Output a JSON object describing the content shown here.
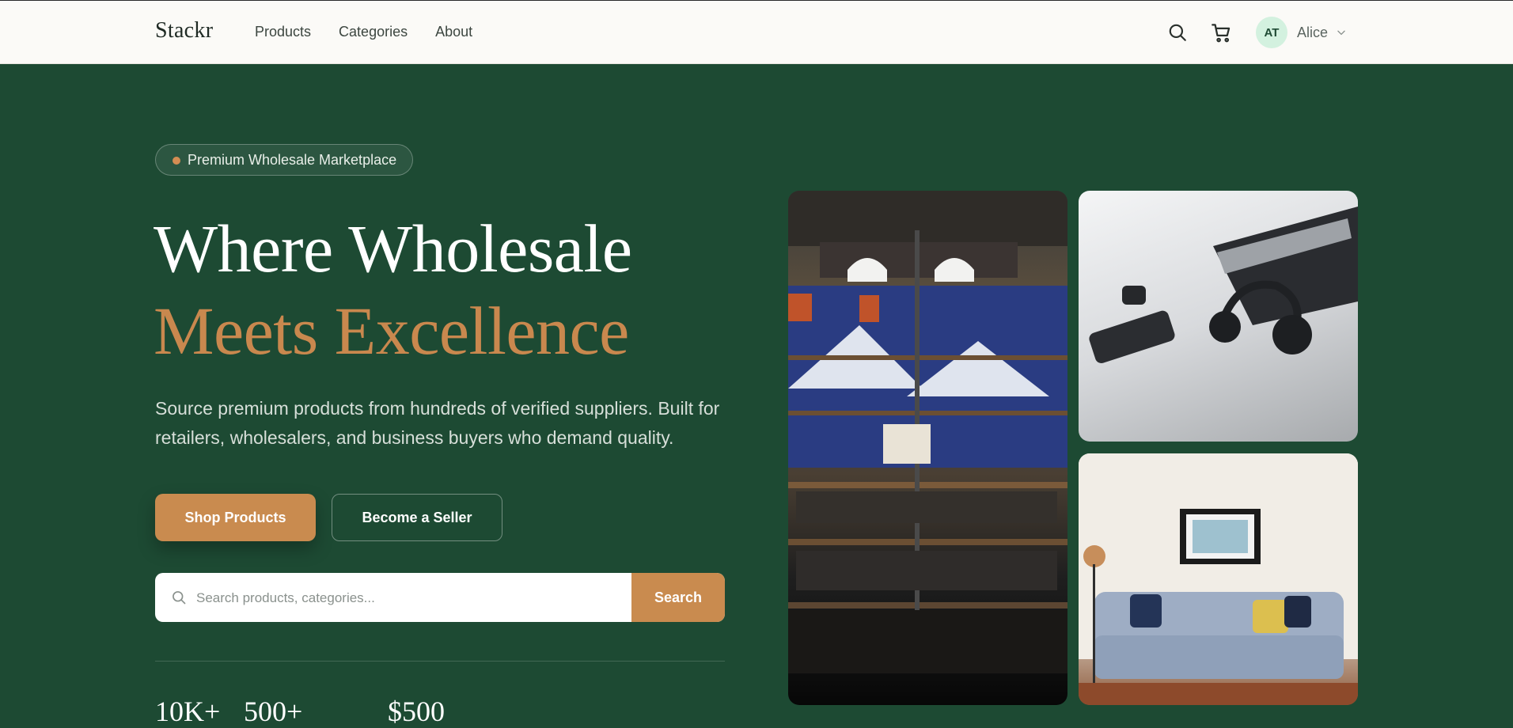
{
  "nav": {
    "logo": "Stackr",
    "links": [
      "Products",
      "Categories",
      "About"
    ],
    "user": {
      "initials": "AT",
      "name": "Alice"
    },
    "icons": [
      "search-icon",
      "cart-icon",
      "chevron-down-icon"
    ]
  },
  "hero": {
    "badge": "Premium Wholesale Marketplace",
    "title_line1": "Where Wholesale",
    "title_line2": "Meets Excellence",
    "lead": "Source premium products from hundreds of verified suppliers. Built for retailers, wholesalers, and business buyers who demand quality.",
    "primary_cta": "Shop Products",
    "secondary_cta": "Become a Seller",
    "search": {
      "placeholder": "Search products, categories...",
      "button": "Search"
    },
    "stats": [
      "10K+",
      "500+",
      "$500"
    ]
  },
  "colors": {
    "background": "#1d4a33",
    "accent": "#c98b4f",
    "nav_bg": "#fbfaf7",
    "avatar_bg": "#d3f1df"
  }
}
